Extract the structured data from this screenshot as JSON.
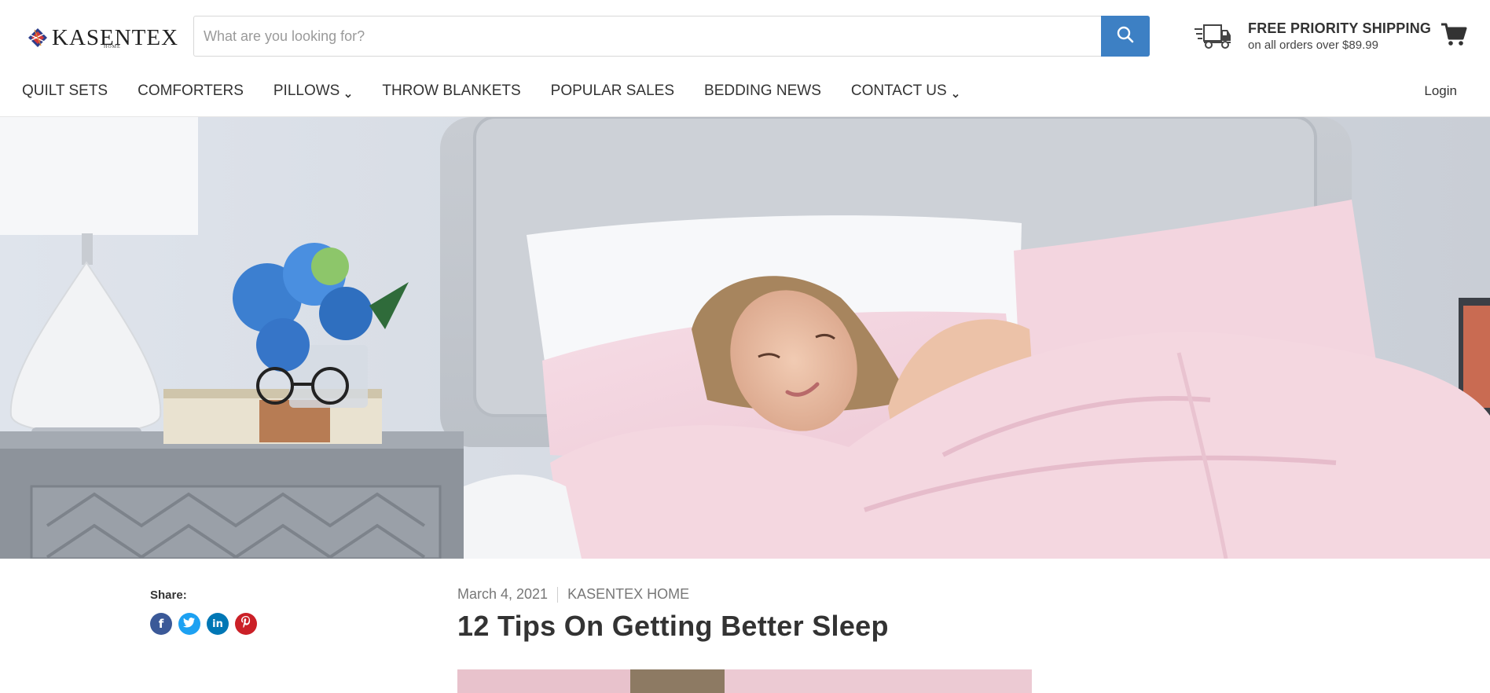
{
  "brand": {
    "name": "KASENTEX",
    "sub": "HOME"
  },
  "search": {
    "placeholder": "What are you looking for?",
    "value": ""
  },
  "shipping": {
    "title": "FREE PRIORITY SHIPPING",
    "subtitle": "on all orders over $89.99"
  },
  "nav": {
    "items": [
      {
        "label": "QUILT SETS",
        "has_dropdown": false
      },
      {
        "label": "COMFORTERS",
        "has_dropdown": false
      },
      {
        "label": "PILLOWS",
        "has_dropdown": true
      },
      {
        "label": "THROW BLANKETS",
        "has_dropdown": false
      },
      {
        "label": "POPULAR SALES",
        "has_dropdown": false
      },
      {
        "label": "BEDDING NEWS",
        "has_dropdown": false
      },
      {
        "label": "CONTACT US",
        "has_dropdown": true
      }
    ],
    "login": "Login"
  },
  "article": {
    "share_label": "Share:",
    "share": [
      {
        "icon": "facebook-icon",
        "glyph": "f",
        "color": "#3b5998"
      },
      {
        "icon": "twitter-icon",
        "glyph": "t",
        "color": "#1da1f2"
      },
      {
        "icon": "linkedin-icon",
        "glyph": "in",
        "color": "#0077b5"
      },
      {
        "icon": "pinterest-icon",
        "glyph": "P",
        "color": "#cb2027"
      }
    ],
    "date": "March 4, 2021",
    "author": "KASENTEX HOME",
    "title": "12 Tips On Getting Better Sleep"
  },
  "colors": {
    "accent": "#3d80c4",
    "text": "#333333",
    "muted": "#777777"
  }
}
